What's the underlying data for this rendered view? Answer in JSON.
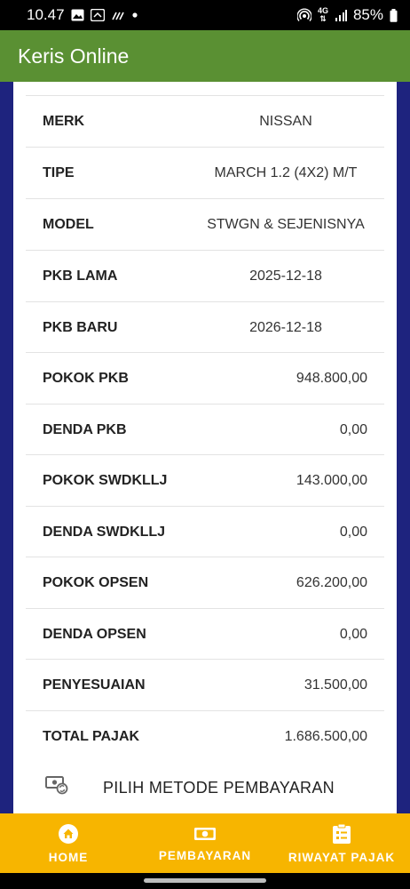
{
  "status_bar": {
    "time": "10.47",
    "signal_label": "4G",
    "battery": "85%"
  },
  "app_bar": {
    "title": "Keris Online"
  },
  "details": [
    {
      "label": "MERK",
      "value": "NISSAN",
      "align": "center"
    },
    {
      "label": "TIPE",
      "value": "MARCH 1.2 (4X2) M/T",
      "align": "center"
    },
    {
      "label": "MODEL",
      "value": "STWGN & SEJENISNYA",
      "align": "center"
    },
    {
      "label": "PKB LAMA",
      "value": "2025-12-18",
      "align": "center"
    },
    {
      "label": "PKB BARU",
      "value": "2026-12-18",
      "align": "center"
    },
    {
      "label": "POKOK PKB",
      "value": "948.800,00",
      "align": "right"
    },
    {
      "label": "DENDA PKB",
      "value": "0,00",
      "align": "right"
    },
    {
      "label": "POKOK SWDKLLJ",
      "value": "143.000,00",
      "align": "right"
    },
    {
      "label": "DENDA SWDKLLJ",
      "value": "0,00",
      "align": "right"
    },
    {
      "label": "POKOK OPSEN",
      "value": "626.200,00",
      "align": "right"
    },
    {
      "label": "DENDA OPSEN",
      "value": "0,00",
      "align": "right"
    },
    {
      "label": "PENYESUAIAN",
      "value": "31.500,00",
      "align": "right"
    },
    {
      "label": "TOTAL PAJAK",
      "value": "1.686.500,00",
      "align": "right"
    }
  ],
  "payment": {
    "label": "PILIH METODE PEMBAYARAN",
    "icon": "payment-exchange-icon"
  },
  "bottom_nav": [
    {
      "label": "HOME",
      "icon": "home-icon"
    },
    {
      "label": "PEMBAYARAN",
      "icon": "money-icon"
    },
    {
      "label": "RIWAYAT PAJAK",
      "icon": "clipboard-icon"
    }
  ],
  "colors": {
    "app_bar": "#5a9033",
    "background": "#1e237e",
    "bottom_nav": "#f7b500"
  }
}
